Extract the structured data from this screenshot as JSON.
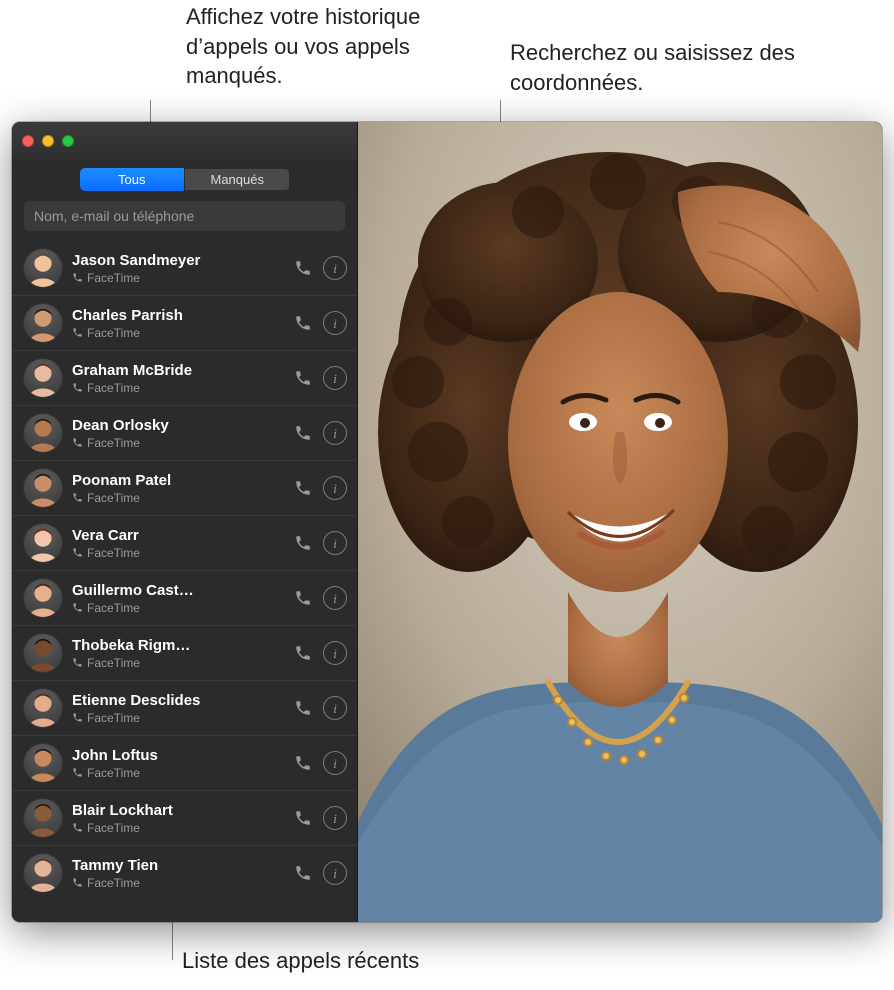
{
  "callouts": {
    "tabs": "Affichez votre historique d’appels ou vos appels manqués.",
    "search": "Recherchez ou saisissez des coordonnées.",
    "list": "Liste des appels récents"
  },
  "window": {
    "traffic_close": "close",
    "traffic_min": "minimize",
    "traffic_zoom": "zoom"
  },
  "tabs": {
    "all": "Tous",
    "missed": "Manqués"
  },
  "search": {
    "placeholder": "Nom, e-mail ou téléphone",
    "value": ""
  },
  "list_sub_label": "FaceTime",
  "contacts": [
    {
      "name": "Jason Sandmeyer",
      "skin": "skin-a"
    },
    {
      "name": "Charles Parrish",
      "skin": "skin-b"
    },
    {
      "name": "Graham McBride",
      "skin": "skin-c"
    },
    {
      "name": "Dean Orlosky",
      "skin": "skin-d"
    },
    {
      "name": "Poonam Patel",
      "skin": "skin-e"
    },
    {
      "name": "Vera Carr",
      "skin": "skin-f"
    },
    {
      "name": "Guillermo Cast…",
      "skin": "skin-g"
    },
    {
      "name": "Thobeka Rigm…",
      "skin": "skin-h"
    },
    {
      "name": "Etienne Desclides",
      "skin": "skin-i"
    },
    {
      "name": "John Loftus",
      "skin": "skin-j"
    },
    {
      "name": "Blair Lockhart",
      "skin": "skin-k"
    },
    {
      "name": "Tammy Tien",
      "skin": "skin-l"
    }
  ],
  "icons": {
    "phone": "phone-icon",
    "info": "info-icon",
    "handset": "handset-icon"
  }
}
